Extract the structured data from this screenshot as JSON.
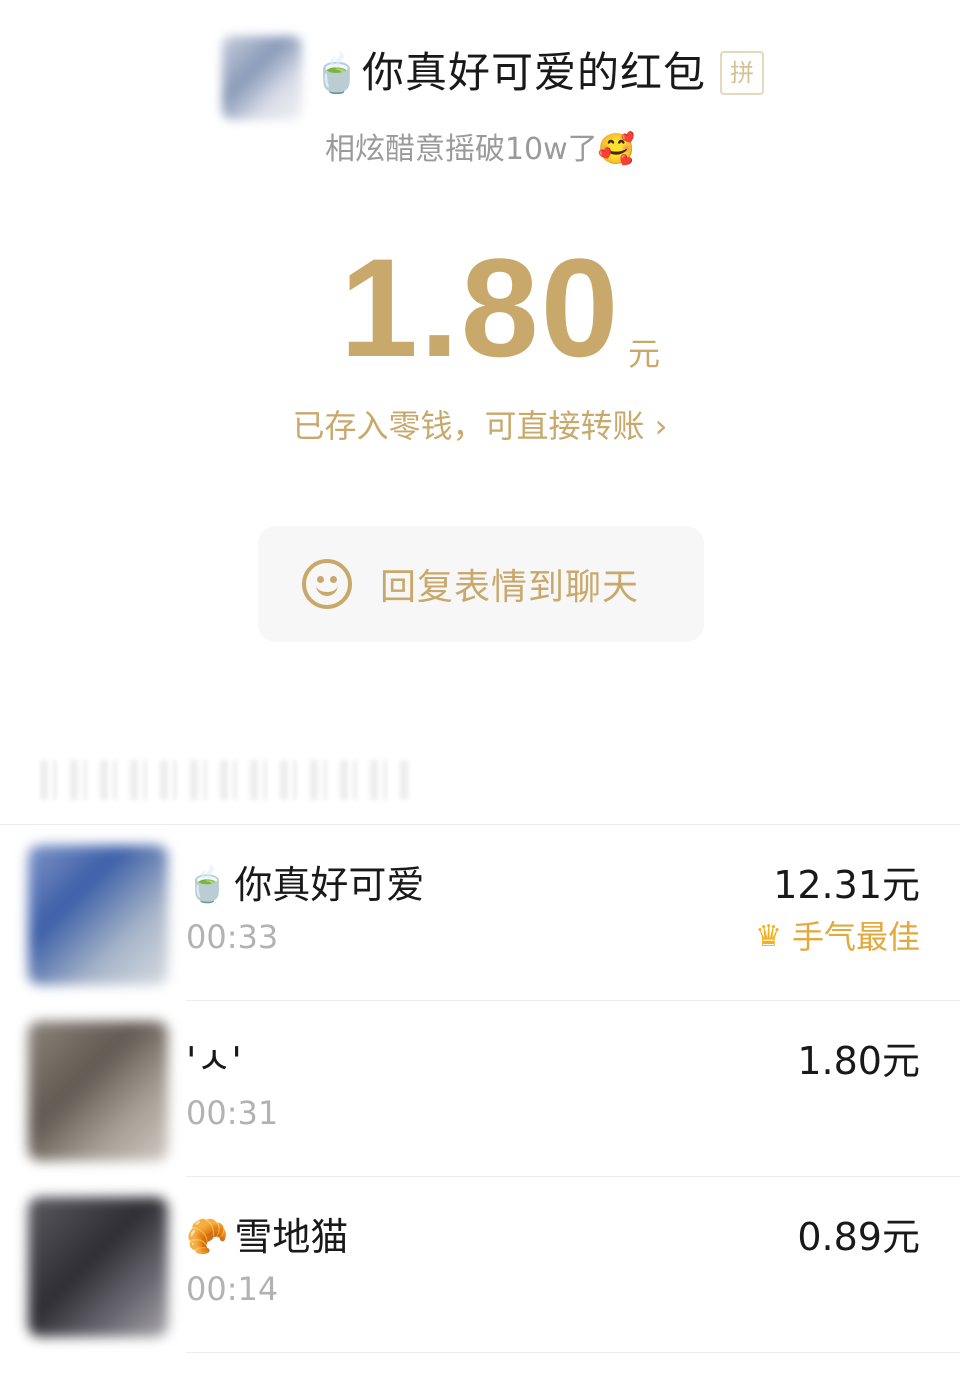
{
  "header": {
    "title_emoji": "🍵",
    "title": "你真好可爱的红包",
    "pin_badge": "拼",
    "subtitle": "相炫醋意摇破10w了🥰"
  },
  "amount": {
    "value": "1.80",
    "unit": "元",
    "stored_text": "已存入零钱，可直接转账 ›"
  },
  "reply_button": {
    "label": "回复表情到聊天"
  },
  "recipients": [
    {
      "emoji": "🍵",
      "name": "你真好可爱",
      "time": "00:33",
      "amount": "12.31元",
      "badge": "手气最佳"
    },
    {
      "emoji": "",
      "name": "'ㅅ'",
      "time": "00:31",
      "amount": "1.80元"
    },
    {
      "emoji": "🥐",
      "name": "雪地猫",
      "time": "00:14",
      "amount": "0.89元"
    }
  ],
  "colors": {
    "gold": "#c9a96b",
    "best_luck": "#e2a93c"
  },
  "icons": {
    "reply": "smiley-icon",
    "best_luck": "crown-icon"
  }
}
